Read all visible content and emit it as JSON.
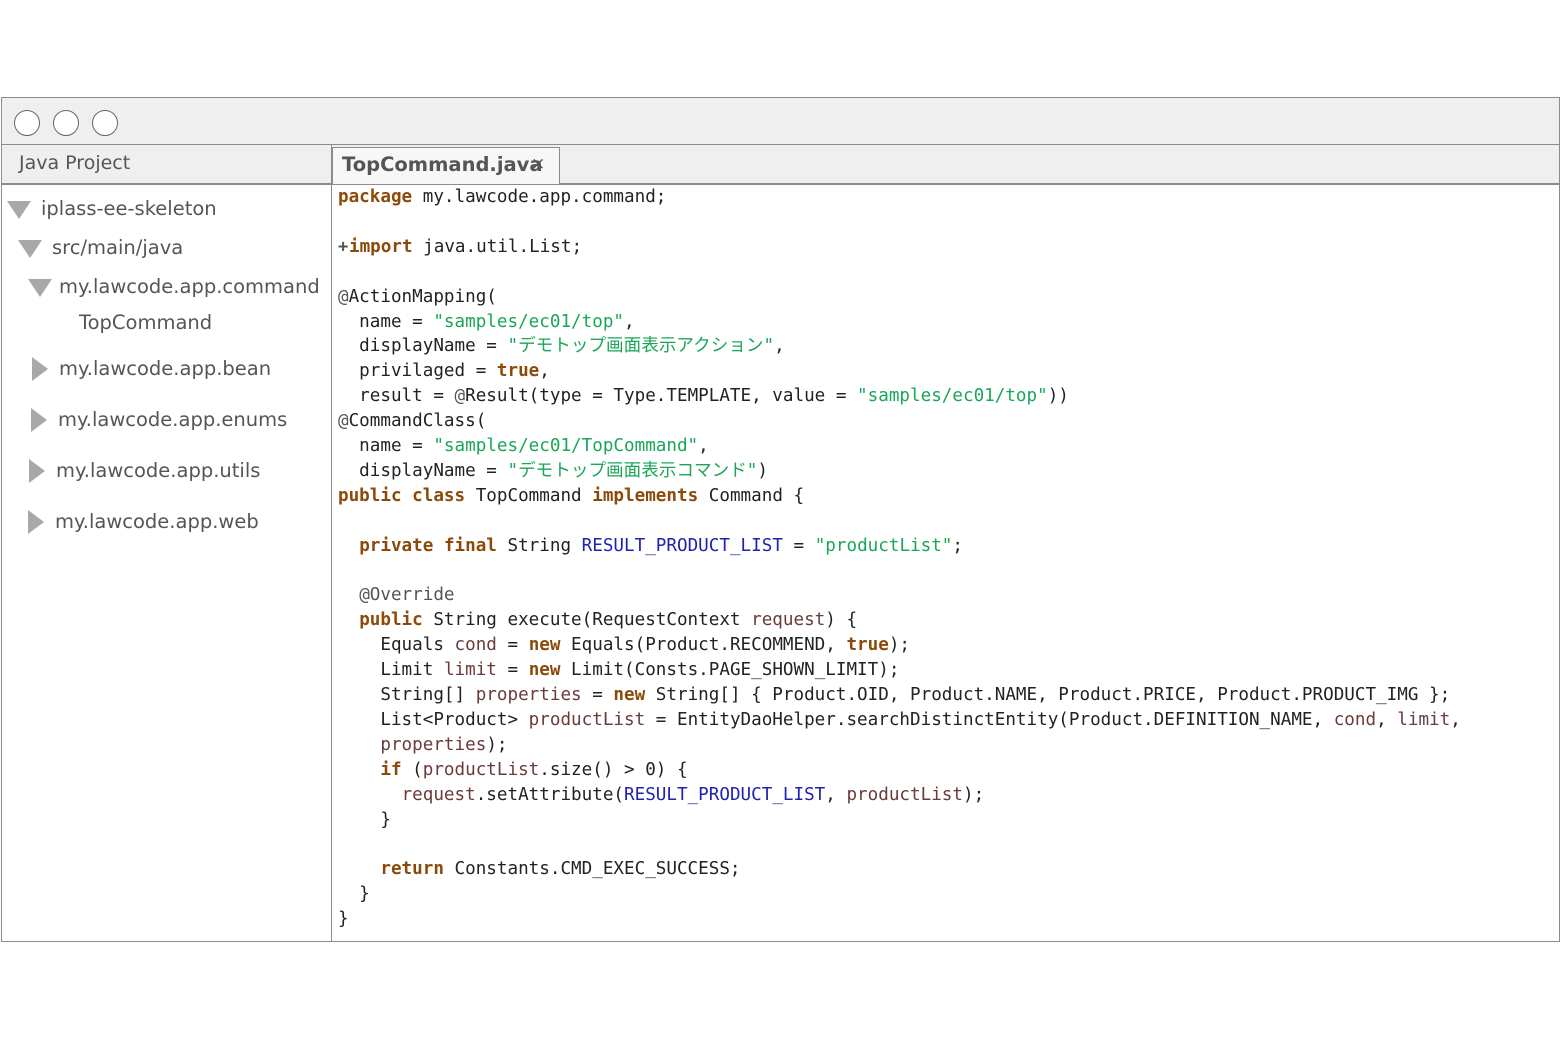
{
  "window": {
    "controls": [
      "close",
      "minimize",
      "maximize"
    ]
  },
  "sidebar": {
    "title": "Java Project",
    "tree": [
      {
        "label": "iplass-ee-skeleton",
        "expanded": true
      },
      {
        "label": "src/main/java",
        "expanded": true
      },
      {
        "label": "my.lawcode.app.command",
        "expanded": true
      },
      {
        "label": "TopCommand",
        "expanded": null
      },
      {
        "label": "my.lawcode.app.bean",
        "expanded": false
      },
      {
        "label": "my.lawcode.app.enums",
        "expanded": false
      },
      {
        "label": "my.lawcode.app.utils",
        "expanded": false
      },
      {
        "label": "my.lawcode.app.web",
        "expanded": false
      }
    ]
  },
  "editor": {
    "tab": {
      "label": "TopCommand.java",
      "close": "×"
    },
    "fold_marker": "+",
    "lines": [
      [
        [
          "k",
          "package"
        ],
        [
          "",
          "my.lawcode.app.command;"
        ]
      ],
      [],
      [
        [
          "k",
          "import"
        ],
        [
          "",
          " java.util.List;"
        ]
      ],
      [],
      [
        [
          "a",
          "@"
        ],
        [
          "",
          "ActionMapping("
        ]
      ],
      [
        [
          "",
          "  name = "
        ],
        [
          "s",
          "\"samples/ec01/top\""
        ],
        [
          "",
          ","
        ]
      ],
      [
        [
          "",
          "  displayName = "
        ],
        [
          "s",
          "\"デモトップ画面表示アクション\""
        ],
        [
          "",
          ","
        ]
      ],
      [
        [
          "",
          "  privilaged = "
        ],
        [
          "k",
          "true"
        ],
        [
          "",
          ","
        ]
      ],
      [
        [
          "",
          "  result = "
        ],
        [
          "a",
          "@"
        ],
        [
          "",
          "Result(type = Type.TEMPLATE, value = "
        ],
        [
          "s",
          "\"samples/ec01/top\""
        ],
        [
          "",
          "))"
        ]
      ],
      [
        [
          "a",
          "@"
        ],
        [
          "",
          "CommandClass("
        ]
      ],
      [
        [
          "",
          "  name = "
        ],
        [
          "s",
          "\"samples/ec01/TopCommand\""
        ],
        [
          "",
          ","
        ]
      ],
      [
        [
          "",
          "  displayName = "
        ],
        [
          "s",
          "\"デモトップ画面表示コマンド\""
        ],
        [
          "",
          ")"
        ]
      ],
      [
        [
          "k",
          "public"
        ],
        [
          "",
          " "
        ],
        [
          "k",
          "class"
        ],
        [
          "",
          " TopCommand "
        ],
        [
          "k",
          "implements"
        ],
        [
          "",
          " Command {"
        ]
      ],
      [],
      [
        [
          "",
          "  "
        ],
        [
          "k",
          "private"
        ],
        [
          "",
          " "
        ],
        [
          "k",
          "final"
        ],
        [
          "",
          " String "
        ],
        [
          "f",
          "RESULT_PRODUCT_LIST"
        ],
        [
          "",
          " = "
        ],
        [
          "s",
          "\"productList\""
        ],
        [
          "",
          ";"
        ]
      ],
      [],
      [
        [
          "",
          "  "
        ],
        [
          "a",
          "@Override"
        ]
      ],
      [
        [
          "",
          "  "
        ],
        [
          "k",
          "public"
        ],
        [
          "",
          " String execute(RequestContext "
        ],
        [
          "v",
          "request"
        ],
        [
          "",
          ") {"
        ]
      ],
      [
        [
          "",
          "    Equals "
        ],
        [
          "v",
          "cond"
        ],
        [
          "",
          " = "
        ],
        [
          "k",
          "new"
        ],
        [
          "",
          " Equals(Product.RECOMMEND, "
        ],
        [
          "k",
          "true"
        ],
        [
          "",
          ");"
        ]
      ],
      [
        [
          "",
          "    Limit "
        ],
        [
          "v",
          "limit"
        ],
        [
          "",
          " = "
        ],
        [
          "k",
          "new"
        ],
        [
          "",
          " Limit(Consts.PAGE_SHOWN_LIMIT);"
        ]
      ],
      [
        [
          "",
          "    String[] "
        ],
        [
          "v",
          "properties"
        ],
        [
          "",
          " = "
        ],
        [
          "k",
          "new"
        ],
        [
          "",
          " String[] { Product.OID, Product.NAME, Product.PRICE, Product.PRODUCT_IMG };"
        ]
      ],
      [
        [
          "",
          "    List<Product> "
        ],
        [
          "v",
          "productList"
        ],
        [
          "",
          " = EntityDaoHelper.searchDistinctEntity(Product.DEFINITION_NAME, "
        ],
        [
          "v",
          "cond"
        ],
        [
          "",
          ", "
        ],
        [
          "v",
          "limit"
        ],
        [
          "",
          ","
        ]
      ],
      [
        [
          "",
          "    "
        ],
        [
          "v",
          "properties"
        ],
        [
          "",
          ");"
        ]
      ],
      [
        [
          "",
          "    "
        ],
        [
          "k",
          "if"
        ],
        [
          "",
          " ("
        ],
        [
          "v",
          "productList"
        ],
        [
          "",
          ".size() > 0) {"
        ]
      ],
      [
        [
          "",
          "      "
        ],
        [
          "v",
          "request"
        ],
        [
          "",
          ".setAttribute("
        ],
        [
          "f",
          "RESULT_PRODUCT_LIST"
        ],
        [
          "",
          ", "
        ],
        [
          "v",
          "productList"
        ],
        [
          "",
          ");"
        ]
      ],
      [
        [
          "",
          "    }"
        ]
      ],
      [],
      [
        [
          "",
          "    "
        ],
        [
          "k",
          "return"
        ],
        [
          "",
          " Constants.CMD_EXEC_SUCCESS;"
        ]
      ],
      [
        [
          "",
          "  }"
        ]
      ],
      [
        [
          "",
          "}"
        ]
      ]
    ]
  }
}
